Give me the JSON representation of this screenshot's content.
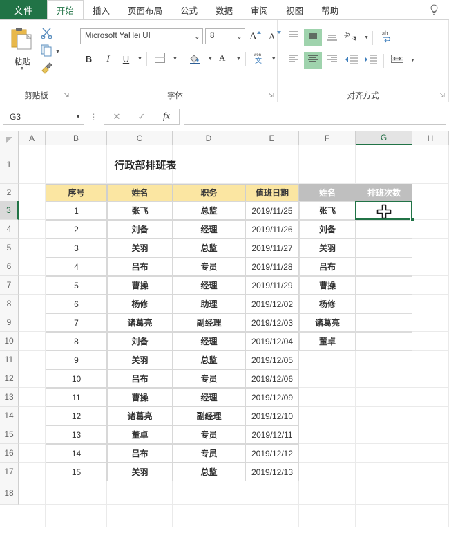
{
  "ribbon": {
    "file_tab": "文件",
    "tabs": [
      {
        "label": "开始",
        "active": true
      },
      {
        "label": "插入",
        "active": false
      },
      {
        "label": "页面布局",
        "active": false
      },
      {
        "label": "公式",
        "active": false
      },
      {
        "label": "数据",
        "active": false
      },
      {
        "label": "审阅",
        "active": false
      },
      {
        "label": "视图",
        "active": false
      },
      {
        "label": "帮助",
        "active": false
      }
    ],
    "tell_me_icon": "lightbulb-icon",
    "groups": {
      "clipboard": {
        "label": "剪贴板",
        "paste_label": "粘贴",
        "paste_icon": "paste-icon",
        "cut_icon": "scissors-icon",
        "copy_icon": "copy-icon",
        "format_painter_icon": "format-painter-icon",
        "dialog_launcher": "⇲"
      },
      "font": {
        "label": "字体",
        "font_name": "Microsoft YaHei UI",
        "font_size": "8",
        "grow_font_icon": "grow-font-icon",
        "shrink_font_icon": "shrink-font-icon",
        "bold_label": "B",
        "italic_label": "I",
        "underline_label": "U",
        "borders_icon": "borders-icon",
        "fill_color_icon": "fill-color-icon",
        "font_color_label": "A",
        "phonetic_icon": "phonetic-guide-icon",
        "dialog_launcher": "⇲"
      },
      "alignment": {
        "label": "对齐方式",
        "align_top_icon": "align-top-icon",
        "align_middle_icon": "align-middle-icon",
        "align_bottom_icon": "align-bottom-icon",
        "orientation_icon": "text-orientation-icon",
        "wrap_text_icon": "wrap-text-icon",
        "align_left_icon": "align-left-icon",
        "align_center_icon": "align-center-icon",
        "align_right_icon": "align-right-icon",
        "decrease_indent_icon": "decrease-indent-icon",
        "increase_indent_icon": "increase-indent-icon",
        "merge_cells_icon": "merge-cells-icon",
        "dialog_launcher": "⇲"
      }
    }
  },
  "formula_bar": {
    "name_box_value": "G3",
    "cancel_icon": "cancel-icon",
    "confirm_icon": "confirm-icon",
    "function_icon": "fx-icon",
    "formula_value": ""
  },
  "grid": {
    "columns": [
      "A",
      "B",
      "C",
      "D",
      "E",
      "F",
      "G",
      "H"
    ],
    "active_column": "G",
    "rows": [
      "1",
      "2",
      "3",
      "4",
      "5",
      "6",
      "7",
      "8",
      "9",
      "10",
      "11",
      "12",
      "13",
      "14",
      "15",
      "16",
      "17",
      "18"
    ],
    "active_row": "3",
    "selected_cell": "G3",
    "cursor_icon": "cell-select-cursor"
  },
  "left_table": {
    "title": "行政部排班表",
    "headers": [
      "序号",
      "姓名",
      "职务",
      "值班日期"
    ],
    "rows": [
      {
        "no": "1",
        "name": "张飞",
        "role": "总监",
        "date": "2019/11/25"
      },
      {
        "no": "2",
        "name": "刘备",
        "role": "经理",
        "date": "2019/11/26"
      },
      {
        "no": "3",
        "name": "关羽",
        "role": "总监",
        "date": "2019/11/27"
      },
      {
        "no": "4",
        "name": "吕布",
        "role": "专员",
        "date": "2019/11/28"
      },
      {
        "no": "5",
        "name": "曹操",
        "role": "经理",
        "date": "2019/11/29"
      },
      {
        "no": "6",
        "name": "杨修",
        "role": "助理",
        "date": "2019/12/02"
      },
      {
        "no": "7",
        "name": "诸葛亮",
        "role": "副经理",
        "date": "2019/12/03"
      },
      {
        "no": "8",
        "name": "刘备",
        "role": "经理",
        "date": "2019/12/04"
      },
      {
        "no": "9",
        "name": "关羽",
        "role": "总监",
        "date": "2019/12/05"
      },
      {
        "no": "10",
        "name": "吕布",
        "role": "专员",
        "date": "2019/12/06"
      },
      {
        "no": "11",
        "name": "曹操",
        "role": "经理",
        "date": "2019/12/09"
      },
      {
        "no": "12",
        "name": "诸葛亮",
        "role": "副经理",
        "date": "2019/12/10"
      },
      {
        "no": "13",
        "name": "董卓",
        "role": "专员",
        "date": "2019/12/11"
      },
      {
        "no": "14",
        "name": "吕布",
        "role": "专员",
        "date": "2019/12/12"
      },
      {
        "no": "15",
        "name": "关羽",
        "role": "总监",
        "date": "2019/12/13"
      }
    ]
  },
  "right_table": {
    "headers": [
      "姓名",
      "排班次数"
    ],
    "rows": [
      {
        "name": "张飞",
        "count": ""
      },
      {
        "name": "刘备",
        "count": ""
      },
      {
        "name": "关羽",
        "count": ""
      },
      {
        "name": "吕布",
        "count": ""
      },
      {
        "name": "曹操",
        "count": ""
      },
      {
        "name": "杨修",
        "count": ""
      },
      {
        "name": "诸葛亮",
        "count": ""
      },
      {
        "name": "董卓",
        "count": ""
      }
    ]
  },
  "colors": {
    "excel_green": "#217346",
    "header_yellow": "#fbe6a2",
    "header_gray": "#bfbfbf",
    "ribbon_accent": "#9fd3ad"
  }
}
